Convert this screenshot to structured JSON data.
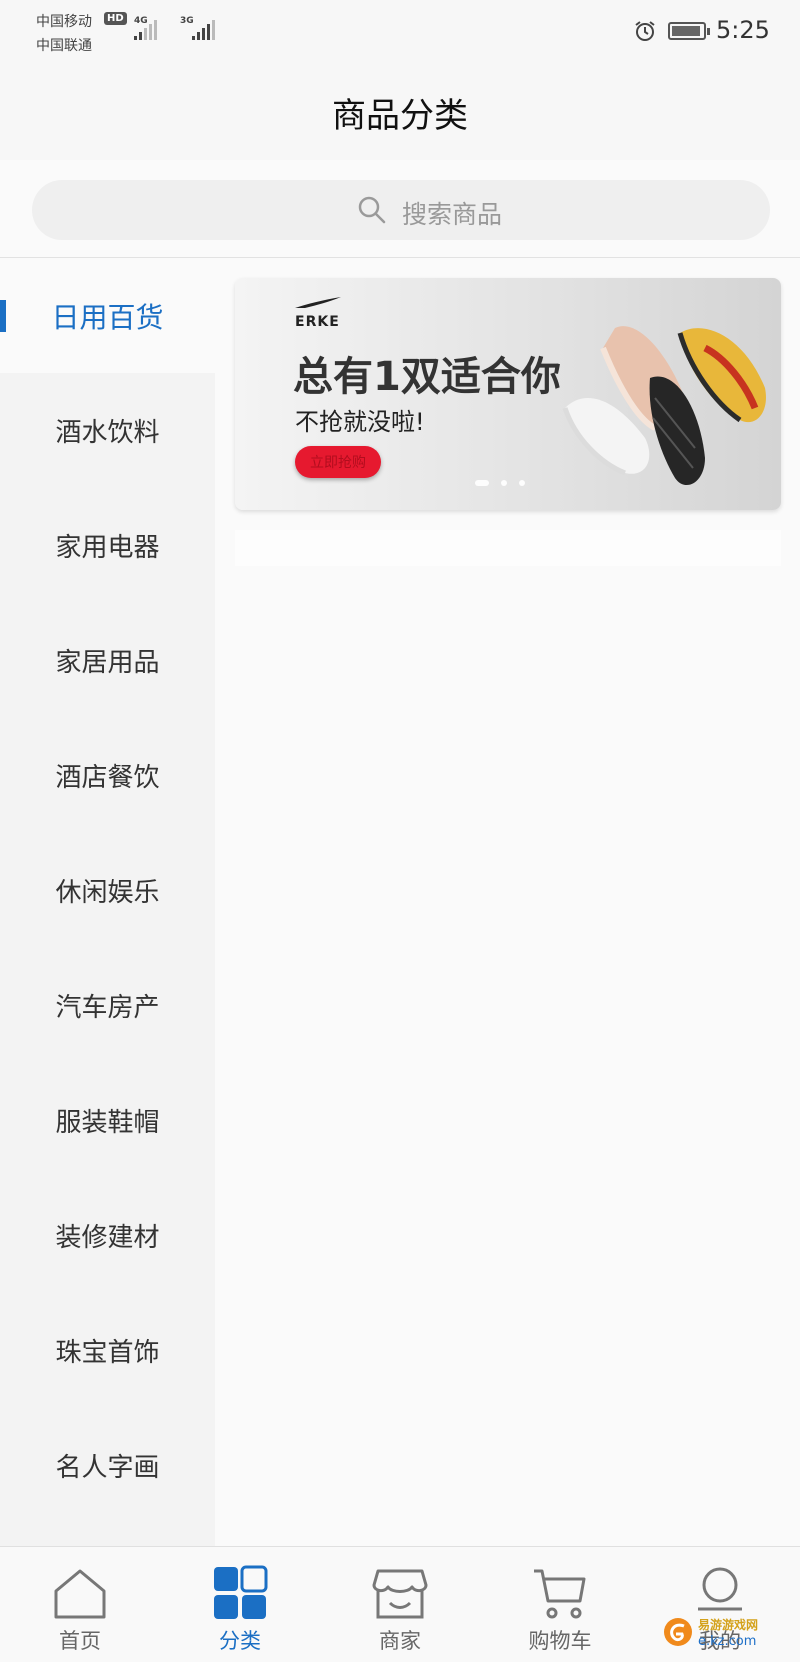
{
  "status_bar": {
    "carrier_1": "中国移动",
    "carrier_1_badge": "HD",
    "carrier_2": "中国联通",
    "network_1": "4G",
    "network_2": "3G",
    "time": "5:25",
    "icons": [
      "alarm-icon",
      "battery-charging-icon"
    ]
  },
  "header": {
    "title": "商品分类"
  },
  "search": {
    "placeholder": "搜索商品",
    "icon": "search-icon"
  },
  "sidebar": {
    "active_index": 0,
    "items": [
      {
        "label": "日用百货"
      },
      {
        "label": "酒水饮料"
      },
      {
        "label": "家用电器"
      },
      {
        "label": "家居用品"
      },
      {
        "label": "酒店餐饮"
      },
      {
        "label": "休闲娱乐"
      },
      {
        "label": "汽车房产"
      },
      {
        "label": "服装鞋帽"
      },
      {
        "label": "装修建材"
      },
      {
        "label": "珠宝首饰"
      },
      {
        "label": "名人字画"
      }
    ]
  },
  "banner": {
    "brand": "ERKE",
    "headline": "总有1双适合你",
    "subline": "不抢就没啦!",
    "button_label": "立即抢购",
    "slide_count": 3,
    "active_slide": 0
  },
  "tabbar": {
    "active_index": 1,
    "items": [
      {
        "label": "首页",
        "icon": "home-icon"
      },
      {
        "label": "分类",
        "icon": "category-grid-icon"
      },
      {
        "label": "商家",
        "icon": "store-icon"
      },
      {
        "label": "购物车",
        "icon": "cart-icon"
      },
      {
        "label": "我的",
        "icon": "profile-icon"
      }
    ]
  },
  "watermark": {
    "site_name": "易游游戏网",
    "domain": "e.kz.com"
  },
  "colors": {
    "accent": "#1b6fc4",
    "banner_button": "#e6192f",
    "sidebar_bg": "#f3f3f3",
    "content_bg": "#fafafa"
  }
}
